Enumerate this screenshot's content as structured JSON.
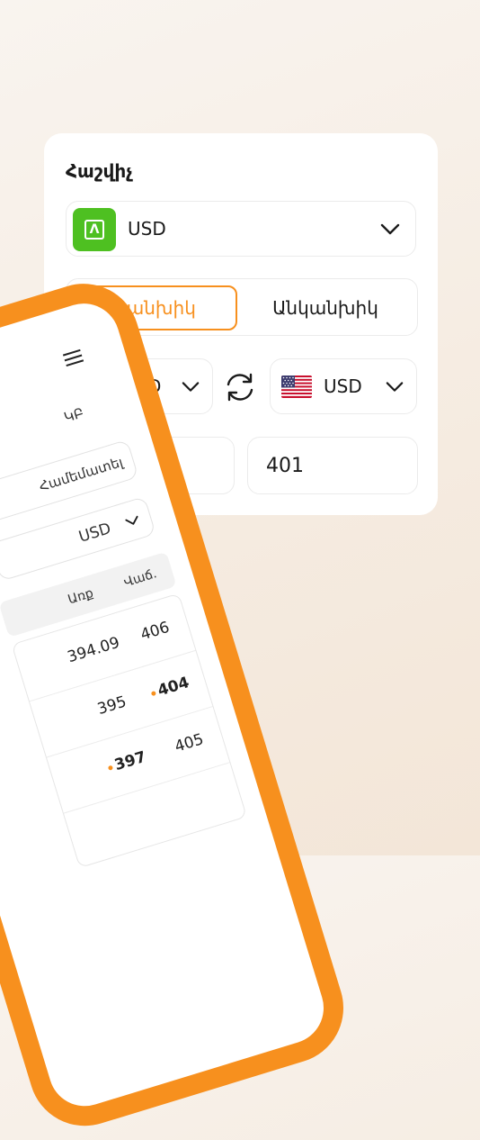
{
  "calculator": {
    "title": "Հաշվիչ",
    "bank_select": {
      "value": "USD",
      "logo_icon": "evocabank-logo-icon",
      "logo_glyph": "Λ"
    },
    "tabs": [
      {
        "label": "Կանխիկ",
        "active": true
      },
      {
        "label": "Անկանխիկ",
        "active": false
      }
    ],
    "from_currency": {
      "code": "AMD",
      "flag": "armenia-flag-icon"
    },
    "to_currency": {
      "code": "USD",
      "flag": "usa-flag-icon"
    },
    "swap_icon": "swap-arrows-icon",
    "amount_from": "",
    "amount_to": "401"
  },
  "phone": {
    "cb_label": "ԿԲ",
    "compare_label": "Համեմատել",
    "currency_value": "USD",
    "columns": {
      "buy": "Առք",
      "sell": "Վաճ."
    },
    "rows": [
      {
        "buy": "394.09",
        "sell": "406",
        "sell_best": false,
        "buy_best": false
      },
      {
        "buy": "395",
        "sell": "404",
        "sell_best": true,
        "buy_best": false
      },
      {
        "buy": "397",
        "sell": "405",
        "sell_best": false,
        "buy_best": true
      }
    ]
  },
  "colors": {
    "accent": "#f7901e",
    "brand_green": "#4ec021"
  }
}
